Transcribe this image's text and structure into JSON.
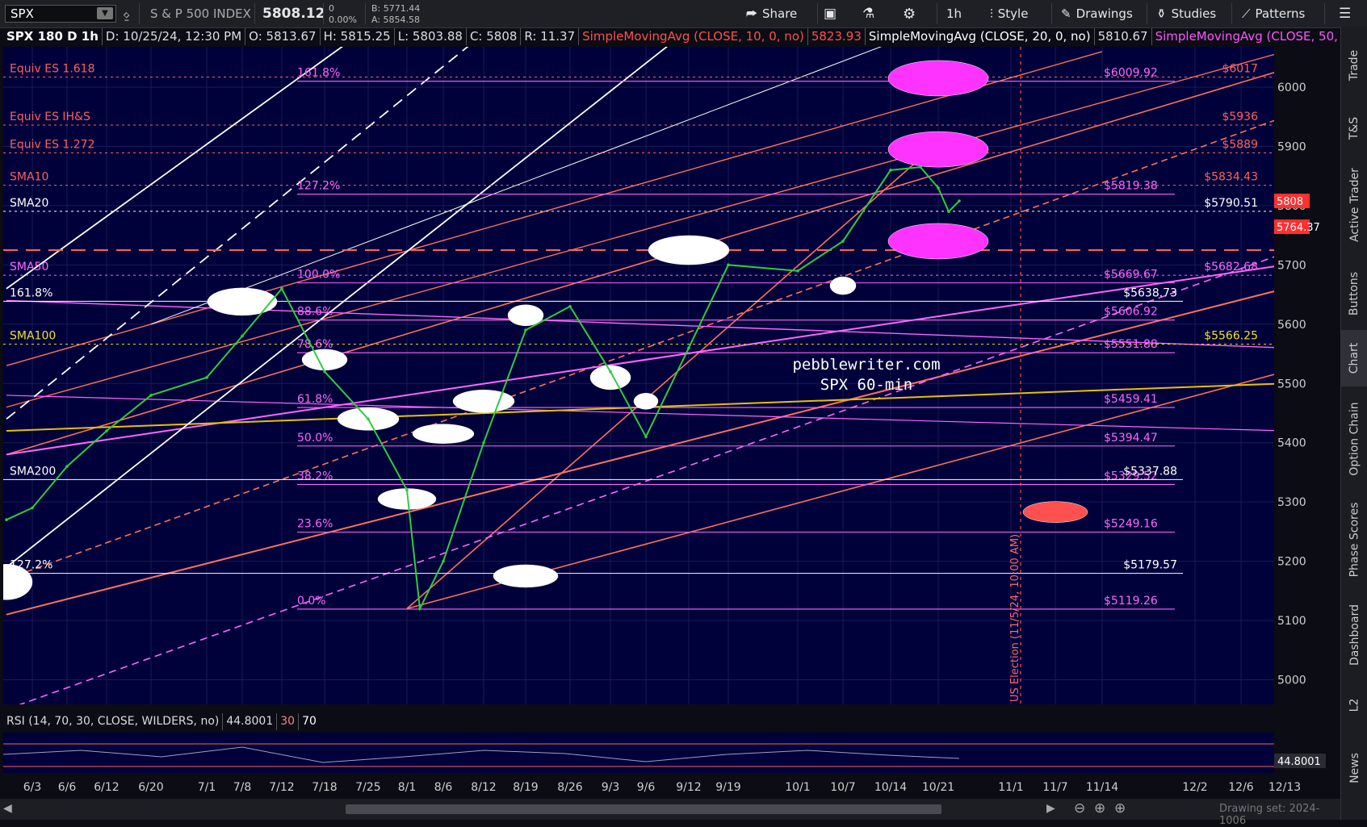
{
  "toolbar": {
    "symbol": "SPX",
    "name": "S & P 500 INDEX",
    "price": "5808.12",
    "change": "0",
    "change_pct": "0.00%",
    "bid": "B: 5771.44",
    "ask": "A: 5854.58",
    "share": "Share",
    "timeframe": "1h",
    "style": "Style",
    "drawings": "Drawings",
    "studies": "Studies",
    "patterns": "Patterns"
  },
  "infobar": {
    "title": "SPX 180 D 1h",
    "date": "D: 10/25/24, 12:30 PM",
    "open": "O: 5813.67",
    "high": "H: 5815.25",
    "low": "L: 5803.88",
    "close": "C: 5808",
    "range": "R: 11.37",
    "sma10_label": "SimpleMovingAvg (CLOSE, 10, 0, no)",
    "sma10_val": "5823.93",
    "sma20_label": "SimpleMovingAvg (CLOSE, 20, 0, no)",
    "sma20_val": "5810.67",
    "sma50_label": "SimpleMovingAvg (CLOSE, 50, 0,..."
  },
  "right_tabs": [
    "Trade",
    "T&S",
    "Active Trader",
    "Buttons",
    "Chart",
    "Option Chain",
    "Phase Scores",
    "Dashboard",
    "L2",
    "News"
  ],
  "rsi": {
    "label": "RSI (14, 70, 30, CLOSE, WILDERS, no)",
    "value": "44.8001",
    "upper": "30",
    "lower": "70"
  },
  "bottom": {
    "drawing_set": "Drawing set: 2024-1006"
  },
  "colors": {
    "bg": "#00003a",
    "sma10": "#ff6347",
    "sma20": "#ffffff",
    "sma50": "#ff55ff",
    "pink": "#ff66ff",
    "salmon": "#ff7060",
    "gold": "#e6c200"
  },
  "chart_data": {
    "type": "line",
    "title": "",
    "watermark": [
      "pebblewriter.com",
      "SPX 60-min"
    ],
    "ylim": [
      4950,
      6105
    ],
    "y_ticks": [
      5000,
      5100,
      5200,
      5300,
      5400,
      5500,
      5600,
      5700,
      5800,
      5900,
      6000
    ],
    "x_ticks": [
      "6/3",
      "6/6",
      "6/12",
      "6/20",
      "7/1",
      "7/8",
      "7/12",
      "7/18",
      "7/25",
      "8/1",
      "8/6",
      "8/12",
      "8/19",
      "8/26",
      "9/3",
      "9/6",
      "9/12",
      "9/19",
      "10/1",
      "10/7",
      "10/14",
      "10/21",
      "11/1",
      "11/7",
      "11/14",
      "12/2",
      "12/6",
      "12/13"
    ],
    "price_path": [
      {
        "x": "5/31",
        "y": 5270
      },
      {
        "x": "6/3",
        "y": 5290
      },
      {
        "x": "6/6",
        "y": 5360
      },
      {
        "x": "6/12",
        "y": 5420
      },
      {
        "x": "6/20",
        "y": 5480
      },
      {
        "x": "7/1",
        "y": 5510
      },
      {
        "x": "7/8",
        "y": 5580
      },
      {
        "x": "7/12",
        "y": 5660
      },
      {
        "x": "7/18",
        "y": 5520
      },
      {
        "x": "7/25",
        "y": 5440
      },
      {
        "x": "8/1",
        "y": 5320
      },
      {
        "x": "8/5",
        "y": 5120
      },
      {
        "x": "8/6",
        "y": 5200
      },
      {
        "x": "8/12",
        "y": 5400
      },
      {
        "x": "8/19",
        "y": 5590
      },
      {
        "x": "8/26",
        "y": 5630
      },
      {
        "x": "9/3",
        "y": 5520
      },
      {
        "x": "9/6",
        "y": 5410
      },
      {
        "x": "9/12",
        "y": 5560
      },
      {
        "x": "9/19",
        "y": 5700
      },
      {
        "x": "10/1",
        "y": 5690
      },
      {
        "x": "10/7",
        "y": 5740
      },
      {
        "x": "10/14",
        "y": 5860
      },
      {
        "x": "10/18",
        "y": 5865
      },
      {
        "x": "10/21",
        "y": 5830
      },
      {
        "x": "10/23",
        "y": 5790
      },
      {
        "x": "10/25",
        "y": 5808
      }
    ],
    "fib_levels": [
      {
        "pct": "161.8%",
        "value": "$6009.92",
        "y": 6010
      },
      {
        "pct": "127.2%",
        "value": "$5819.38",
        "y": 5819.38
      },
      {
        "pct": "100.0%",
        "value": "$5669.67",
        "y": 5669.67
      },
      {
        "pct": "88.6%",
        "value": "$5606.92",
        "y": 5606.92
      },
      {
        "pct": "78.6%",
        "value": "$5551.88",
        "y": 5551.88
      },
      {
        "pct": "61.8%",
        "value": "$5459.41",
        "y": 5459.41
      },
      {
        "pct": "50.0%",
        "value": "$5394.47",
        "y": 5394.47
      },
      {
        "pct": "38.2%",
        "value": "$5329.52",
        "y": 5329.52
      },
      {
        "pct": "23.6%",
        "value": "$5249.16",
        "y": 5249.16
      },
      {
        "pct": "0.0%",
        "value": "$5119.26",
        "y": 5119.26
      }
    ],
    "level_labels": [
      {
        "text": "Equiv ES 1.618",
        "value": "$6017",
        "y": 6017,
        "color": "#ff6060"
      },
      {
        "text": "Equiv ES IH&S",
        "value": "$5936",
        "y": 5936,
        "color": "#ff6060"
      },
      {
        "text": "Equiv ES 1.272",
        "value": "$5889",
        "y": 5889,
        "color": "#ff6060"
      },
      {
        "text": "SMA10",
        "value": "$5834.43",
        "y": 5834.43,
        "color": "#ff6060"
      },
      {
        "text": "SMA20",
        "value": "$5790.51",
        "y": 5790.51,
        "color": "#ffffff"
      },
      {
        "text": "SMA50",
        "value": "$5682.68",
        "y": 5682.68,
        "color": "#ff66ff"
      },
      {
        "text": "SMA100",
        "value": "$5566.25",
        "y": 5566.25,
        "color": "#f0e020"
      }
    ],
    "other_levels": [
      {
        "text": "161.8%",
        "value": "$5638.73",
        "y": 5638.73
      },
      {
        "text": "127.2%",
        "value": "$5179.57",
        "y": 5179.57
      },
      {
        "text": "SMA200",
        "value": "$5337.88",
        "y": 5337.88
      }
    ],
    "price_tags": [
      {
        "value": "5808",
        "y": 5808,
        "color": "#ff3030"
      },
      {
        "value": "5764.37",
        "y": 5764.37,
        "color": "#ff3030"
      }
    ],
    "event_label": "US Election (11/5/24, 10:00 AM)"
  }
}
